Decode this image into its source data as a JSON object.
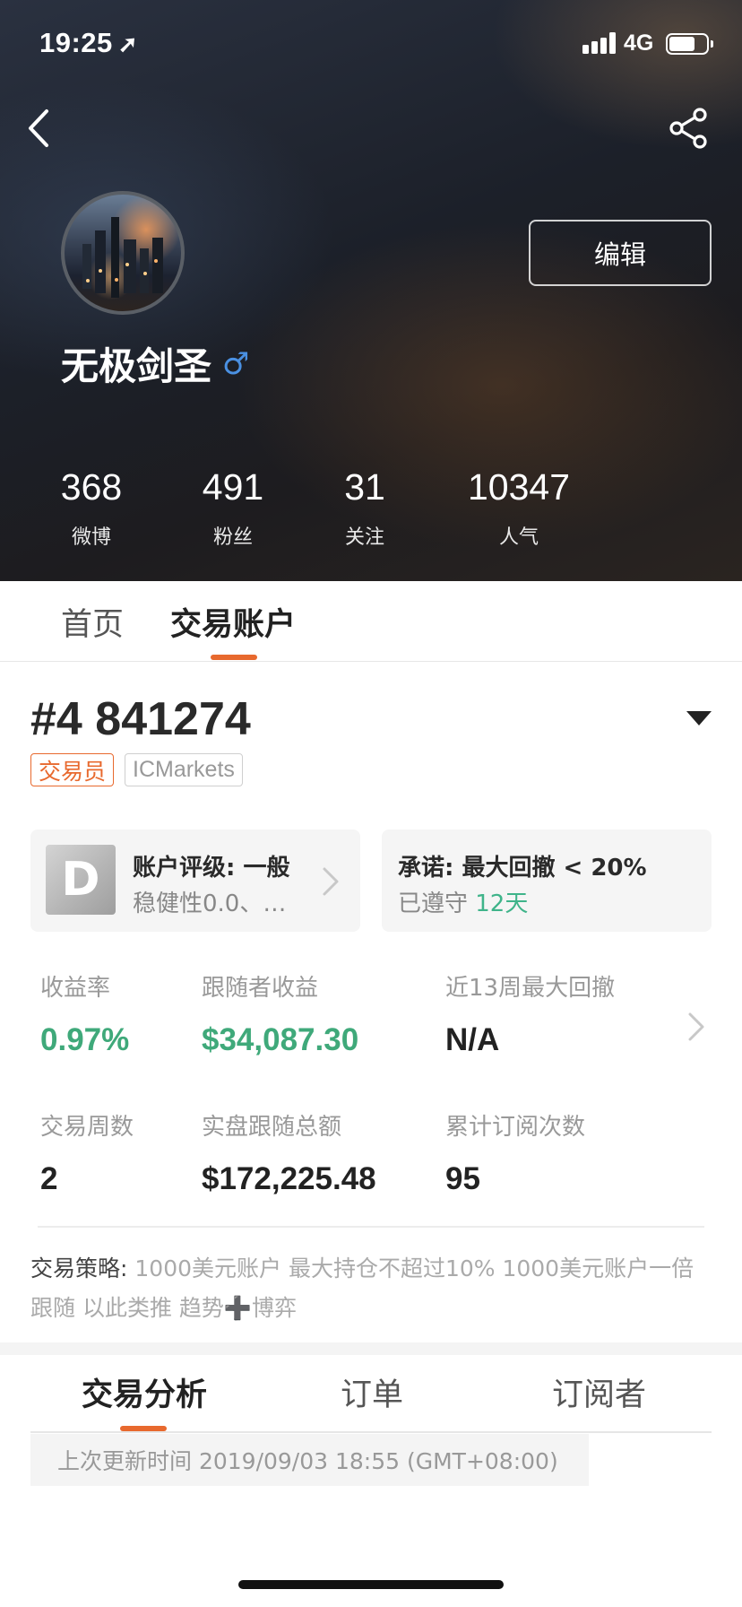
{
  "status_bar": {
    "time": "19:25",
    "network": "4G"
  },
  "profile": {
    "username": "无极剑圣",
    "gender_symbol": "♂",
    "edit_label": "编辑",
    "stats": [
      {
        "value": "368",
        "label": "微博"
      },
      {
        "value": "491",
        "label": "粉丝"
      },
      {
        "value": "31",
        "label": "关注"
      },
      {
        "value": "10347",
        "label": "人气"
      }
    ]
  },
  "profile_tabs": [
    "首页",
    "交易账户"
  ],
  "account": {
    "title": "#4 841274",
    "badges": [
      "交易员",
      "ICMarkets"
    ],
    "rating_card": {
      "grade": "D",
      "title": "账户评级: 一般",
      "subtitle": "稳健性0.0、…"
    },
    "promise_card": {
      "title": "承诺: 最大回撤 < 20%",
      "subtitle_prefix": "已遵守 ",
      "subtitle_value": "12天"
    },
    "metrics": [
      {
        "label": "收益率",
        "value": "0.97%"
      },
      {
        "label": "跟随者收益",
        "value": "$34,087.30"
      },
      {
        "label": "近13周最大回撤",
        "value": "N/A"
      },
      {
        "label": "交易周数",
        "value": "2"
      },
      {
        "label": "实盘跟随总额",
        "value": "$172,225.48"
      },
      {
        "label": "累计订阅次数",
        "value": "95"
      }
    ],
    "strategy_label": "交易策略:",
    "strategy_text": " 1000美元账户  最大持仓不超过10%  1000美元账户一倍跟随  以此类推  趋势➕博弈"
  },
  "analysis_tabs": [
    "交易分析",
    "订单",
    "订阅者"
  ],
  "last_update": "上次更新时间 2019/09/03 18:55 (GMT+08:00)",
  "colors": {
    "accent": "#e8692e",
    "positive": "#3fa97a",
    "grade_bg": "#b3b3b3"
  }
}
